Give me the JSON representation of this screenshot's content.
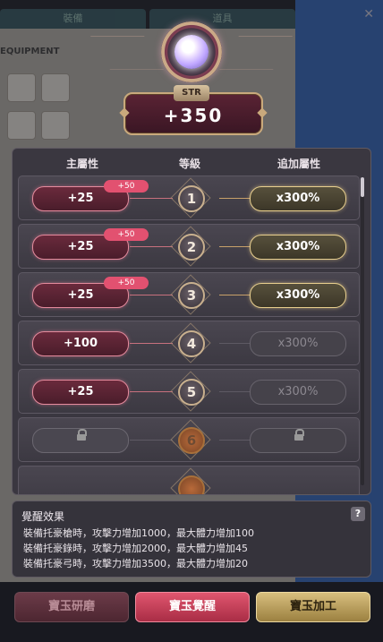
{
  "background": {
    "tabs": [
      "裝備",
      "道具"
    ],
    "section_label": "EQUIPMENT"
  },
  "header": {
    "stat_name": "STR",
    "stat_value": "+350"
  },
  "table": {
    "col_main": "主屬性",
    "col_level": "等級",
    "col_extra": "追加屬性",
    "rows": [
      {
        "main": "+25",
        "bonus": "+50",
        "level": "1",
        "extra": "x300%"
      },
      {
        "main": "+25",
        "bonus": "+50",
        "level": "2",
        "extra": "x300%"
      },
      {
        "main": "+25",
        "bonus": "+50",
        "level": "3",
        "extra": "x300%"
      },
      {
        "main": "+100",
        "bonus": "",
        "level": "4",
        "extra": "x300%"
      },
      {
        "main": "+25",
        "bonus": "",
        "level": "5",
        "extra": "x300%"
      },
      {
        "main": "",
        "bonus": "",
        "level": "6",
        "extra": ""
      }
    ]
  },
  "effect": {
    "title": "覺醒效果",
    "help": "?",
    "lines": [
      "裝備托豪槍時，攻擊力增加1000，最大體力增加100",
      "裝備托豪錄時，攻擊力增加2000，最大體力增加45",
      "裝備托豪弓時，攻擊力增加3500，最大體力增加20"
    ]
  },
  "buttons": {
    "polish": "寶玉研磨",
    "awaken": "寶玉覺醒",
    "process": "寶玉加工"
  },
  "colors": {
    "accent_pink": "#e25170",
    "gold": "#e8cf8e"
  }
}
